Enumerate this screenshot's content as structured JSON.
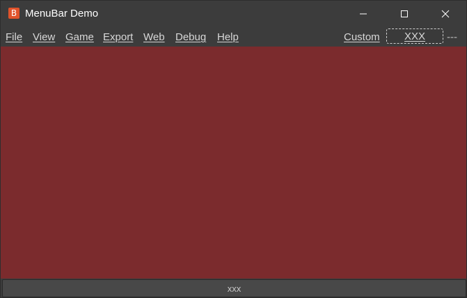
{
  "window": {
    "title": "MenuBar Demo",
    "app_icon_glyph": "B",
    "icons": [
      "app-icon",
      "minimize-icon",
      "maximize-icon",
      "close-icon"
    ]
  },
  "menubar": {
    "items": [
      {
        "label": "File"
      },
      {
        "label": "View"
      },
      {
        "label": "Game"
      },
      {
        "label": "Export"
      },
      {
        "label": "Web"
      },
      {
        "label": "Debug"
      },
      {
        "label": "Help"
      }
    ],
    "custom_label": "Custom",
    "custom_box_label": "XXX",
    "separator_text": "---"
  },
  "statusbar": {
    "label": "xxx"
  },
  "colors": {
    "window_bg": "#3c3c3c",
    "content_bg": "#7b2b2d",
    "app_icon_bg": "#e0532b",
    "text": "#d8d8d8"
  }
}
